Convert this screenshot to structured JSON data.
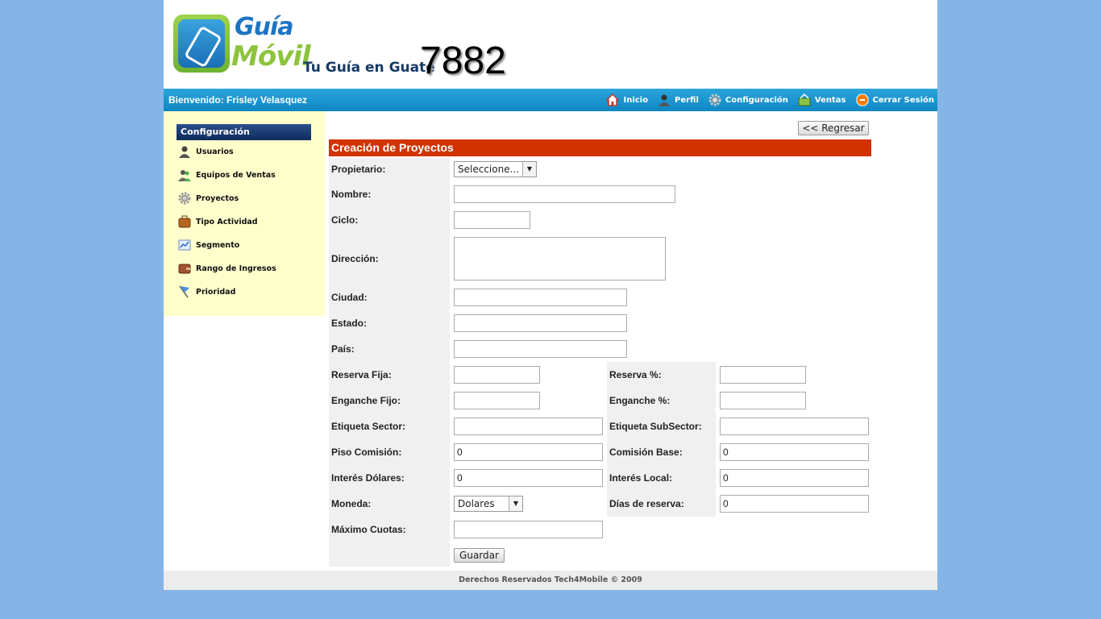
{
  "header": {
    "logo_line1": "Guía",
    "logo_line2": "Móvil",
    "tagline": "Tu Guía en Guate",
    "tagnum": "7882"
  },
  "navbar": {
    "welcome": "Bienvenido: Frisley Velasquez",
    "links": [
      {
        "label": "Inicio",
        "icon": "house-icon"
      },
      {
        "label": "Perfil",
        "icon": "user-icon"
      },
      {
        "label": "Configuración",
        "icon": "gear-icon"
      },
      {
        "label": "Ventas",
        "icon": "cart-icon"
      },
      {
        "label": "Cerrar Sesión",
        "icon": "logout-icon"
      }
    ]
  },
  "sidebar": {
    "title": "Configuración",
    "items": [
      {
        "label": "Usuarios",
        "icon": "user-icon"
      },
      {
        "label": "Equipos de Ventas",
        "icon": "team-icon"
      },
      {
        "label": "Proyectos",
        "icon": "gear-icon"
      },
      {
        "label": "Tipo Actividad",
        "icon": "briefcase-icon"
      },
      {
        "label": "Segmento",
        "icon": "chart-icon"
      },
      {
        "label": "Rango de Ingresos",
        "icon": "wallet-icon"
      },
      {
        "label": "Prioridad",
        "icon": "flag-icon"
      }
    ]
  },
  "main": {
    "back_button": "<< Regresar",
    "form_title": "Creación de Proyectos",
    "propietario": {
      "label": "Propietario:",
      "value": "Seleccione..."
    },
    "nombre": {
      "label": "Nombre:",
      "value": ""
    },
    "ciclo": {
      "label": "Ciclo:",
      "value": ""
    },
    "direccion": {
      "label": "Dirección:",
      "value": ""
    },
    "ciudad": {
      "label": "Ciudad:",
      "value": ""
    },
    "estado": {
      "label": "Estado:",
      "value": ""
    },
    "pais": {
      "label": "País:",
      "value": ""
    },
    "reserva_fija": {
      "label": "Reserva Fija:",
      "value": ""
    },
    "reserva_pct": {
      "label": "Reserva %:",
      "value": ""
    },
    "enganche_fijo": {
      "label": "Enganche Fijo:",
      "value": ""
    },
    "enganche_pct": {
      "label": "Enganche %:",
      "value": ""
    },
    "etiqueta_sector": {
      "label": "Etiqueta Sector:",
      "value": ""
    },
    "etiqueta_subsector": {
      "label": "Etiqueta SubSector:",
      "value": ""
    },
    "piso_comision": {
      "label": "Piso Comisión:",
      "value": "0"
    },
    "comision_base": {
      "label": "Comisión Base:",
      "value": "0"
    },
    "interes_dolares": {
      "label": "Interés Dólares:",
      "value": "0"
    },
    "interes_local": {
      "label": "Interés Local:",
      "value": "0"
    },
    "moneda": {
      "label": "Moneda:",
      "value": "Dolares"
    },
    "dias_reserva": {
      "label": "Días de reserva:",
      "value": "0"
    },
    "maximo_cuotas": {
      "label": "Máximo Cuotas:",
      "value": ""
    },
    "save_button": "Guardar"
  },
  "footer": {
    "text": "Derechos Reservados Tech4Mobile © 2009"
  }
}
